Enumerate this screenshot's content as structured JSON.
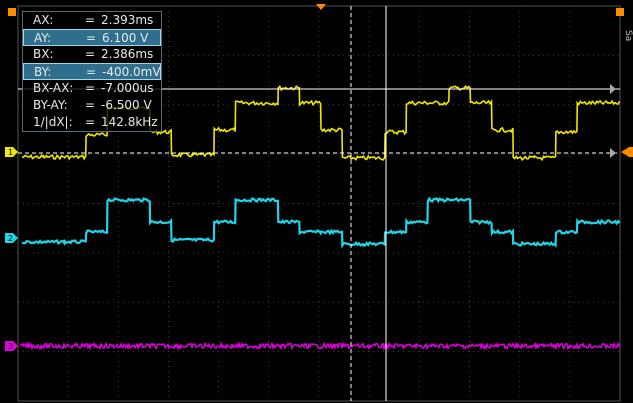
{
  "readouts": [
    {
      "label": "AX:",
      "value": "2.393ms",
      "selected": false
    },
    {
      "label": "AY:",
      "value": "6.100 V",
      "selected": true
    },
    {
      "label": "BX:",
      "value": "2.386ms",
      "selected": false
    },
    {
      "label": "BY:",
      "value": "-400.0mV",
      "selected": true
    },
    {
      "label": "BX-AX:",
      "value": "-7.000us",
      "selected": false
    },
    {
      "label": "BY-AY:",
      "value": "-6.500 V",
      "selected": false
    },
    {
      "label": "1/|dX|:",
      "value": "142.8kHz",
      "selected": false
    }
  ],
  "equals": "=",
  "side_text": "Sa",
  "channels": [
    {
      "id": "1",
      "color": "#f0e600"
    },
    {
      "id": "2",
      "color": "#1fd4e6"
    },
    {
      "id": "3",
      "color": "#e000e0"
    }
  ],
  "colors": {
    "grid": "#3a3a3a",
    "cursor": "#ffffff",
    "trigger": "#ff8c00",
    "background": "#000000"
  }
}
